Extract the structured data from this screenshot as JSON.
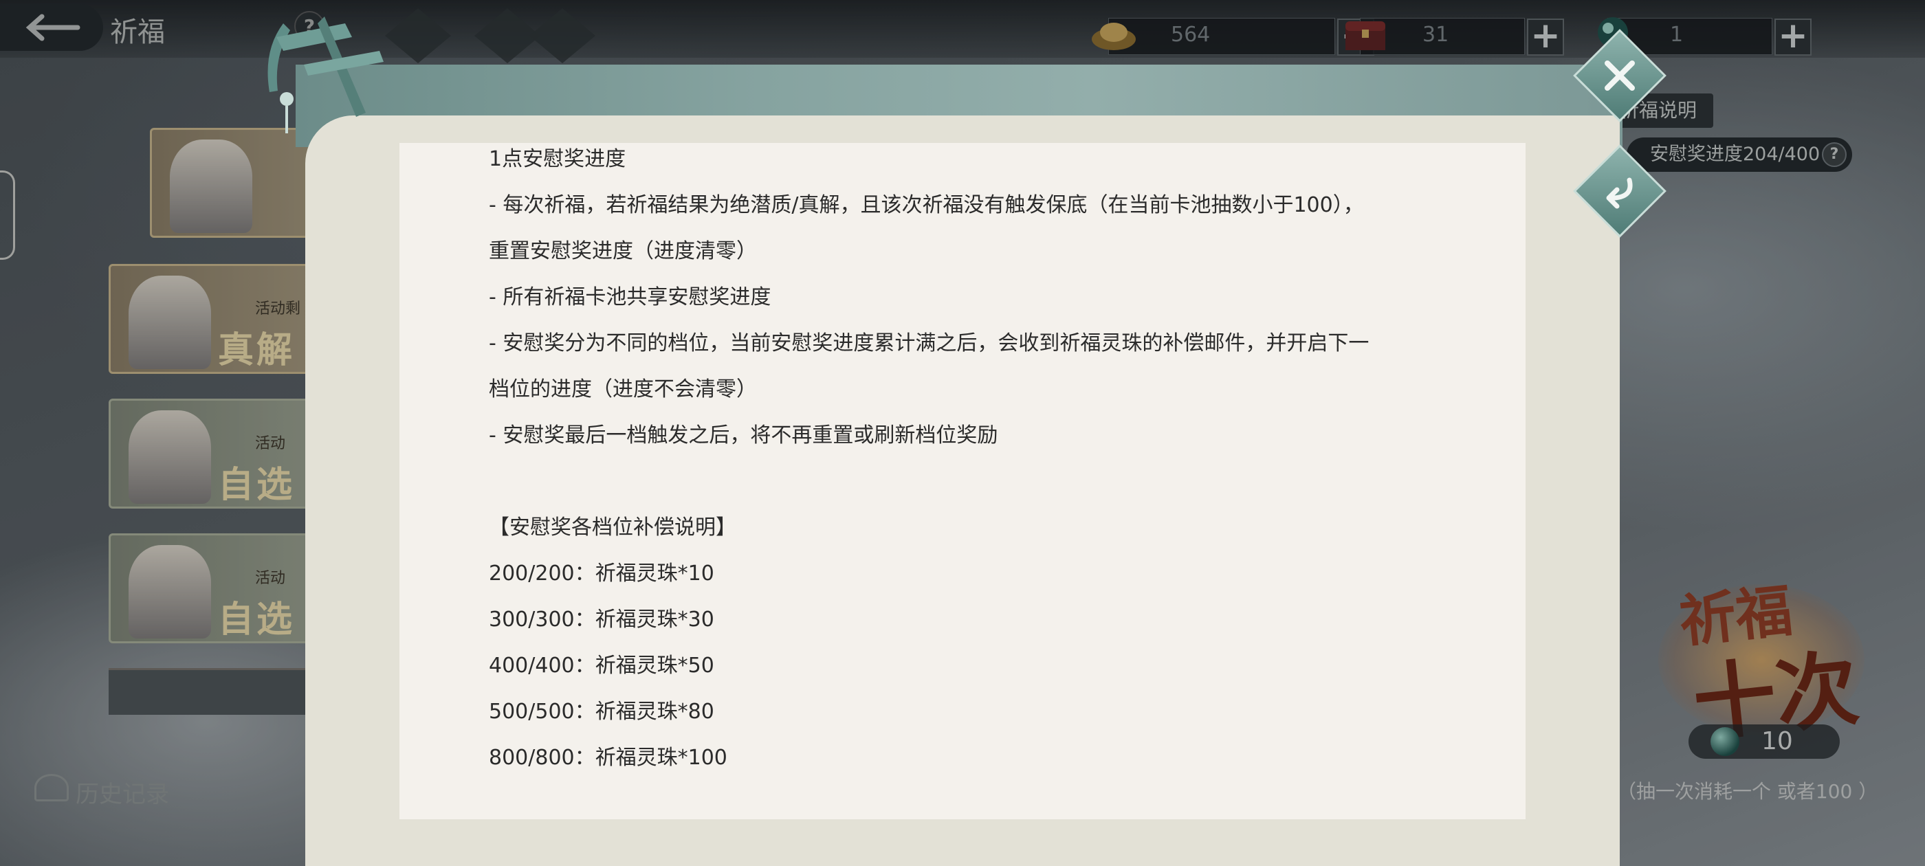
{
  "topbar": {
    "title": "祈福",
    "help": "?",
    "currencies": [
      {
        "icon": "gold-ingot-icon",
        "value": "564"
      },
      {
        "icon": "treasure-chest-icon",
        "value": "31"
      },
      {
        "icon": "spirit-orb-icon",
        "value": "1"
      }
    ],
    "plus": "+"
  },
  "left_pools": [
    {
      "caption": "活动剩",
      "title": "真解活"
    },
    {
      "caption": "活动",
      "title": "自选祈"
    },
    {
      "caption": "活动",
      "title": "自选真"
    }
  ],
  "history_label": "历史记录",
  "right_panel": {
    "info_link": "祈福说明",
    "consolation_progress": "安慰奖进度204/400",
    "help": "?",
    "pray_ten_line1": "祈福",
    "pray_ten_line2": "十次",
    "cost_value": "10",
    "cost_note": "（抽一次消耗一个   或者100   ）"
  },
  "modal": {
    "lines": [
      "1点安慰奖进度",
      "- 每次祈福，若祈福结果为绝潜质/真解，且该次祈福没有触发保底（在当前卡池抽数小于100），",
      "重置安慰奖进度（进度清零）",
      "- 所有祈福卡池共享安慰奖进度",
      "- 安慰奖分为不同的档位，当前安慰奖进度累计满之后，会收到祈福灵珠的补偿邮件，并开启下一",
      "档位的进度（进度不会清零）",
      "- 安慰奖最后一档触发之后，将不再重置或刷新档位奖励",
      "",
      "【安慰奖各档位补偿说明】",
      "200/200：祈福灵珠*10",
      "300/300：祈福灵珠*30",
      "400/400：祈福灵珠*50",
      "500/500：祈福灵珠*80",
      "800/800：祈福灵珠*100"
    ]
  }
}
